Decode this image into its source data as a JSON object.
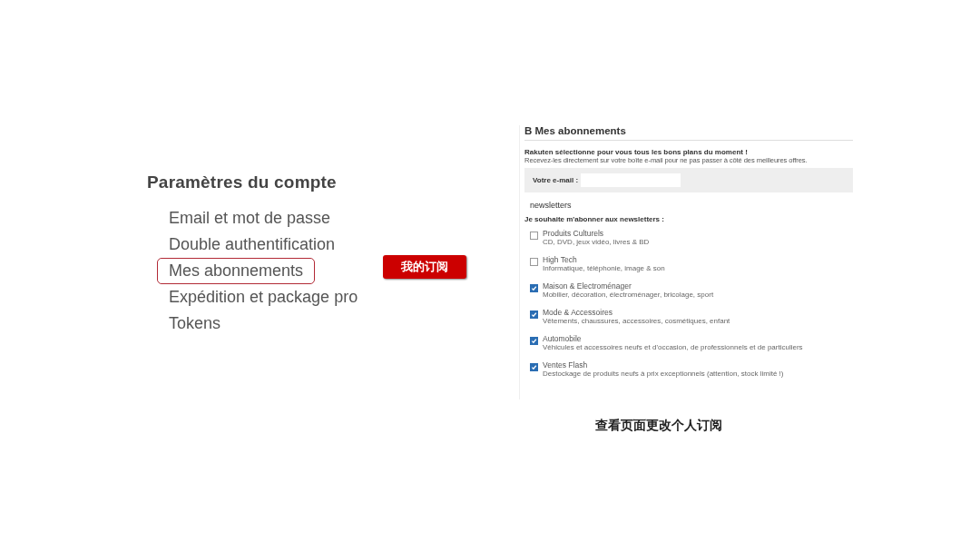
{
  "account_menu": {
    "title": "Paramètres du compte",
    "items": [
      {
        "label": "Email et mot de passe",
        "selected": false
      },
      {
        "label": "Double authentification",
        "selected": false
      },
      {
        "label": "Mes abonnements",
        "selected": true
      },
      {
        "label": "Expédition et package pro",
        "selected": false
      },
      {
        "label": "Tokens",
        "selected": false
      }
    ]
  },
  "callout": {
    "label": "我的订阅"
  },
  "subscriptions_page": {
    "title": "B Mes abonnements",
    "intro_bold": "Rakuten sélectionne pour vous tous les bons plans du moment !",
    "intro": "Recevez-les directement sur votre boîte e-mail pour ne pas passer à côté des meilleures offres.",
    "email_label": "Votre e-mail :",
    "section_title": "newsletters",
    "prompt": "Je souhaite m'abonner aux newsletters :",
    "newsletters": [
      {
        "name": "Produits Culturels",
        "description": "CD, DVD, jeux vidéo, livres & BD",
        "checked": false
      },
      {
        "name": "High Tech",
        "description": "Informatique, téléphonie, image & son",
        "checked": false
      },
      {
        "name": "Maison & Electroménager",
        "description": "Mobilier, décoration, électroménager, bricolage, sport",
        "checked": true
      },
      {
        "name": "Mode & Accessoires",
        "description": "Vêtements, chaussures, accessoires, cosmétiques, enfant",
        "checked": true
      },
      {
        "name": "Automobile",
        "description": "Véhicules et accessoires neufs et d'occasion, de professionnels et de particuliers",
        "checked": true
      },
      {
        "name": "Ventes Flash",
        "description": "Destockage de produits neufs à prix exceptionnels (attention, stock limité !)",
        "checked": true
      }
    ]
  },
  "caption": "查看页面更改个人订阅"
}
